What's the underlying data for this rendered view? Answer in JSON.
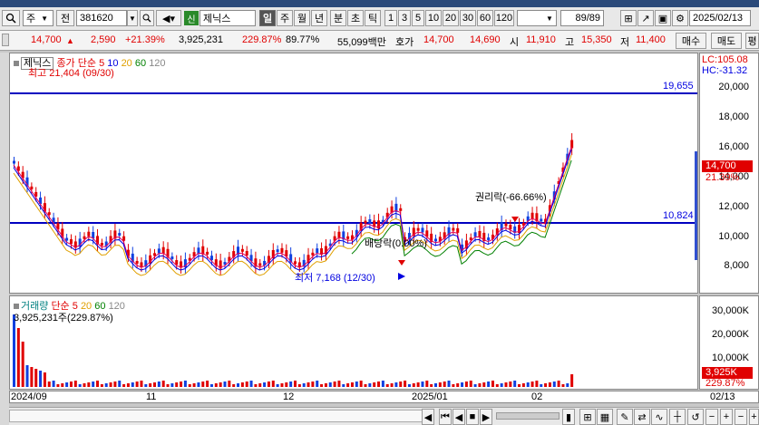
{
  "toolbar": {
    "period": "주",
    "scope": "전",
    "code": "381620",
    "sin_badge": "신",
    "stock_name": "제닉스",
    "tabs": [
      "일",
      "주",
      "월",
      "년",
      "분",
      "초",
      "틱"
    ],
    "intervals": [
      "1",
      "3",
      "5",
      "10",
      "20",
      "30",
      "60",
      "120"
    ],
    "page": "89/89",
    "date": "2025/02/13"
  },
  "quote": {
    "price": "14,700",
    "change": "2,590",
    "change_pct": "+21.39%",
    "volume": "3,925,231",
    "volume_ratio": "229.87%",
    "turnover": "89.77%",
    "amount": "55,099백만",
    "hoga_label": "호가",
    "ask": "14,700",
    "bid": "14,690",
    "open_label": "시",
    "open": "11,910",
    "high_label": "고",
    "high": "15,350",
    "low_label": "저",
    "low": "11,400",
    "buy": "매수",
    "sell": "매도",
    "extra": "평"
  },
  "price_panel": {
    "name": "제닉스",
    "legend": [
      "종가",
      "단순",
      "5",
      "10",
      "20",
      "60",
      "120"
    ],
    "legend_colors": [
      "#e00000",
      "#e00000",
      "#e00000",
      "#0000e0",
      "#e0a000",
      "#008000",
      "#888888"
    ],
    "lc": "LC:105.08",
    "hc": "HC:-31.32",
    "max_label": "최고 21,404 (09/30)",
    "min_label": "최저 7,168 (12/30)",
    "dividend_label": "배당락(0.00%)",
    "rights_label": "권리락(-66.66%)",
    "line_high": "19,655",
    "line_mid": "10,824",
    "cur_price_tag": "14,700",
    "cur_pct_tag": "21.39%",
    "yticks": [
      "20,000",
      "18,000",
      "16,000",
      "14,000",
      "12,000",
      "10,000",
      "8,000"
    ]
  },
  "volume_panel": {
    "legend": [
      "거래량",
      "단순",
      "5",
      "20",
      "60",
      "120"
    ],
    "legend_colors": [
      "#008080",
      "#e00000",
      "#e00000",
      "#e0a000",
      "#008000",
      "#888888"
    ],
    "vol_label": "3,925,231주(229.87%)",
    "vol_tag": "3,925K",
    "vol_pct_tag": "229.87%",
    "yticks": [
      "30,000K",
      "20,000K",
      "10,000K"
    ]
  },
  "xaxis": {
    "labels": [
      "2024/09",
      "11",
      "12",
      "2025/01",
      "02"
    ],
    "right": "02/13"
  }
}
